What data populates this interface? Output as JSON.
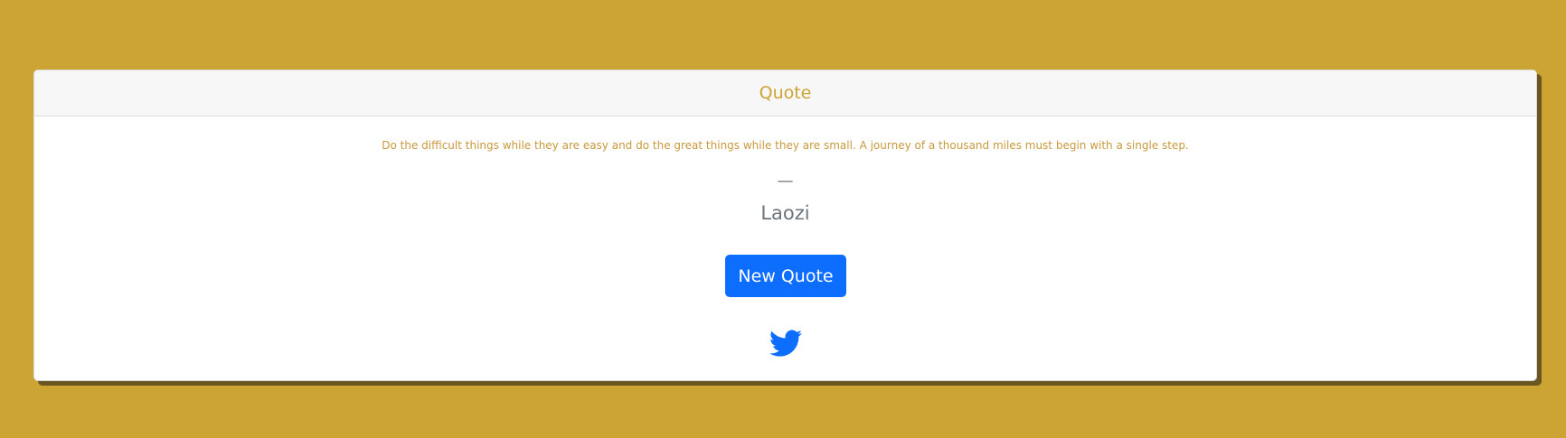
{
  "card": {
    "header": "Quote",
    "quote": "Do the difficult things while they are easy and do the great things while they are small. A journey of a thousand miles must begin with a single step.",
    "dash": "—",
    "author": "Laozi",
    "button_label": "New Quote",
    "share_icon": "twitter-icon"
  },
  "colors": {
    "background": "#cca433",
    "accent": "#cca433",
    "button": "#0d6efd",
    "twitter": "#0d6efd"
  }
}
